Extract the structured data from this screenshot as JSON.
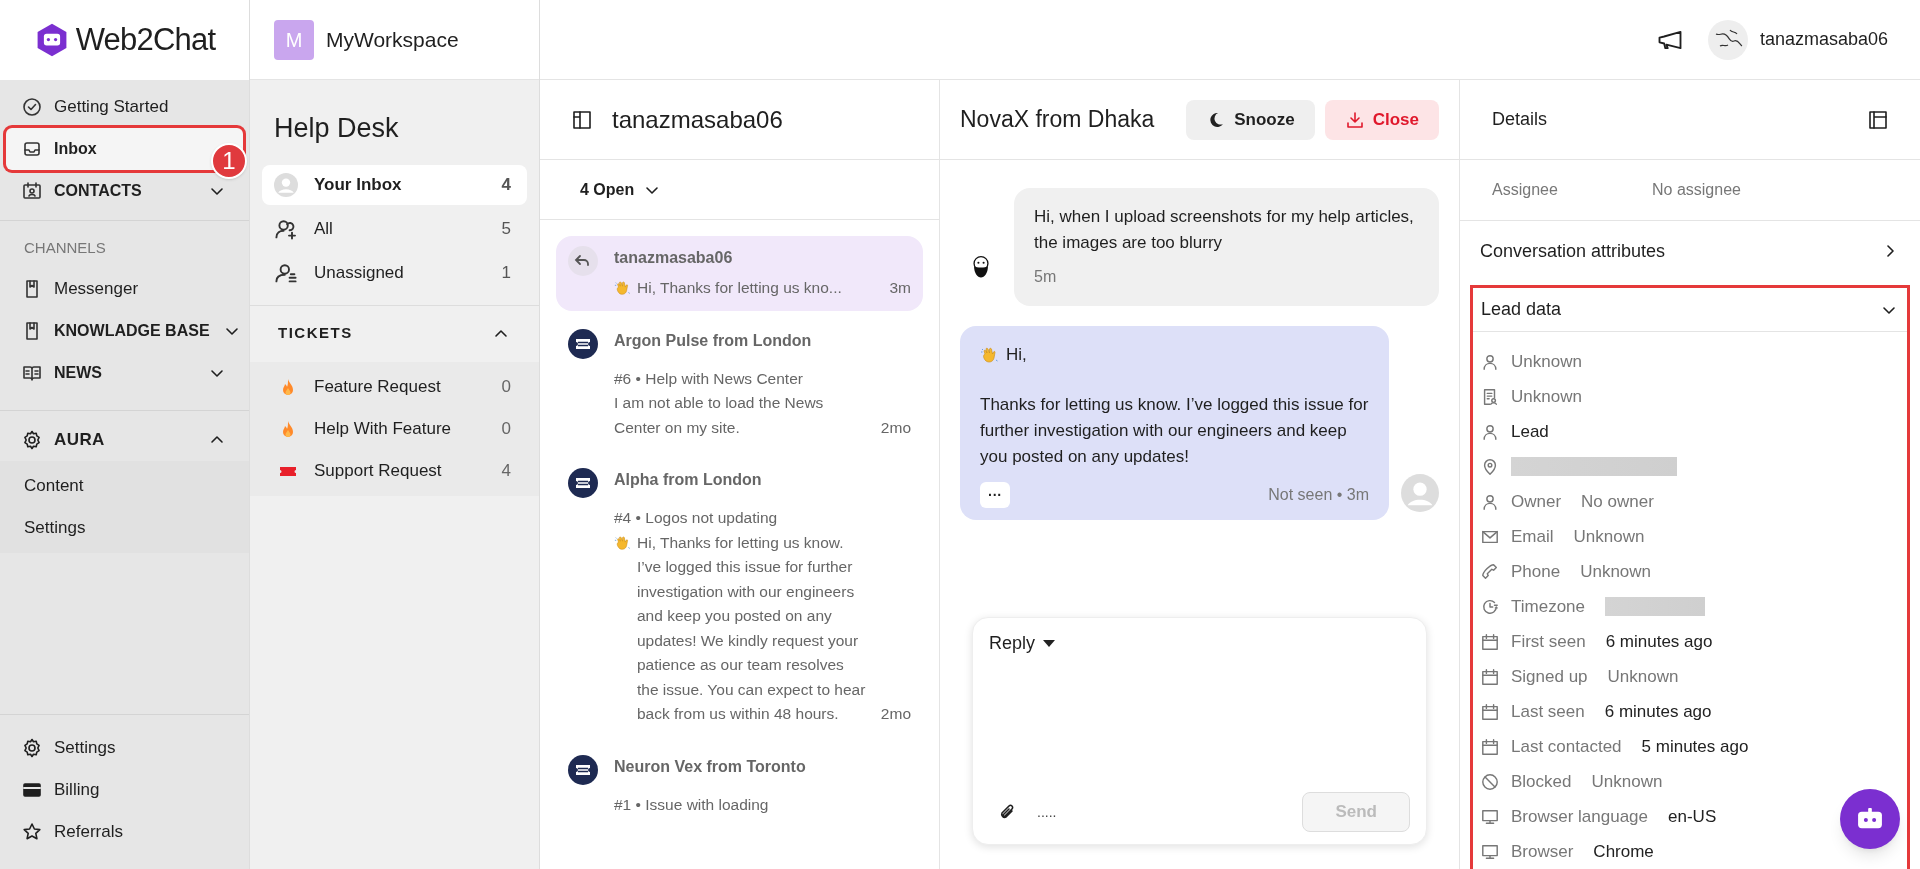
{
  "brand": {
    "name": "Web2Chat"
  },
  "workspace": {
    "initial": "M",
    "name": "MyWorkspace"
  },
  "topbar": {
    "user": "tanazmasaba06"
  },
  "nav": {
    "top": [
      {
        "kind": "check",
        "label": "Getting Started",
        "bold": false,
        "selected": false,
        "highlighted": false
      },
      {
        "kind": "inbox",
        "label": "Inbox",
        "bold": true,
        "selected": true,
        "highlighted": true,
        "callout": "1"
      },
      {
        "kind": "contacts",
        "label": "CONTACTS",
        "bold": true,
        "selected": false,
        "highlighted": false,
        "expanded": false
      }
    ],
    "channels_heading": "CHANNELS",
    "channels": [
      {
        "kind": "book",
        "label": "Messenger",
        "bold": false,
        "selected": false,
        "highlighted": false
      },
      {
        "kind": "book",
        "label": "KNOWLADGE BASE",
        "bold": true,
        "selected": false,
        "highlighted": false,
        "expanded": false
      },
      {
        "kind": "news",
        "label": "NEWS",
        "bold": true,
        "selected": false,
        "highlighted": false,
        "expanded": false
      }
    ],
    "aura": {
      "label": "AURA",
      "expanded": true,
      "children": [
        {
          "label": "Content"
        },
        {
          "label": "Settings"
        }
      ]
    },
    "bottom": [
      {
        "kind": "gear",
        "label": "Settings"
      },
      {
        "kind": "card",
        "label": "Billing"
      },
      {
        "kind": "star",
        "label": "Referrals"
      }
    ]
  },
  "helpdesk": {
    "title": "Help Desk",
    "views": [
      {
        "kind": "avatar",
        "label": "Your Inbox",
        "count": "4",
        "selected": true
      },
      {
        "kind": "people",
        "label": "All",
        "count": "5",
        "selected": false
      },
      {
        "kind": "unassigned",
        "label": "Unassigned",
        "count": "1",
        "selected": false
      }
    ],
    "tickets": {
      "label": "TICKETS",
      "expanded": true,
      "items": [
        {
          "kind": "flame",
          "label": "Feature Request",
          "count": "0"
        },
        {
          "kind": "flame",
          "label": "Help With Feature",
          "count": "0"
        },
        {
          "kind": "ticket",
          "label": "Support Request",
          "count": "4"
        }
      ]
    }
  },
  "conversations": {
    "title": "tanazmasaba06",
    "filter": "4 Open",
    "items": [
      {
        "kind": "reply",
        "name": "tanazmasaba06",
        "preview": "Hi, Thanks for letting us kno...",
        "wave": true,
        "time": "3m",
        "selected": true
      },
      {
        "kind": "ticket",
        "name": "Argon Pulse from London",
        "subject": "#6 • Help with News Center",
        "preview": "I am not able to load the News Center on my site.",
        "wave": false,
        "time": "2mo",
        "selected": false
      },
      {
        "kind": "ticket",
        "name": "Alpha from London",
        "subject": "#4 • Logos not updating",
        "preview": "Hi, Thanks for letting us know. I’ve logged this issue for further investigation with our engineers and keep you posted on any updates! We kindly request your patience as our team resolves the issue. You can expect to hear back from us within 48 hours.",
        "wave": true,
        "time": "2mo",
        "selected": false
      },
      {
        "kind": "ticket",
        "name": "Neuron Vex from Toronto",
        "subject": "#1 • Issue with loading",
        "selected": false
      }
    ]
  },
  "chat": {
    "title": "NovaX from Dhaka",
    "snooze": "Snooze",
    "close": "Close",
    "messages": [
      {
        "kind": "incoming",
        "paragraphs": [
          "Hi, when I upload screenshots for my help articles, the images are too blurry"
        ],
        "time": "5m"
      },
      {
        "kind": "outgoing",
        "greeting": "Hi,",
        "paragraphs": [
          "Thanks for letting us know. I’ve logged this issue for further investigation with our engineers and keep you posted on any updates!"
        ],
        "more": "···",
        "status": "Not seen • 3m"
      }
    ],
    "composer": {
      "mode": "Reply",
      "hint": ".....",
      "send": "Send",
      "send_disabled": true
    }
  },
  "details": {
    "title": "Details",
    "assignee": {
      "label": "Assignee",
      "value": "No assignee"
    },
    "attributes": {
      "label": "Conversation attributes",
      "expanded": false
    },
    "lead_data": {
      "label": "Lead data",
      "expanded": true,
      "highlighted": true,
      "rows": [
        {
          "kind": "person",
          "value": "Unknown",
          "muted": true
        },
        {
          "kind": "contact-card",
          "value": "Unknown",
          "muted": true
        },
        {
          "kind": "person",
          "value": "Lead",
          "muted": false
        },
        {
          "kind": "location",
          "redacted": true
        },
        {
          "kind": "person",
          "label": "Owner",
          "value": "No owner",
          "muted": true
        },
        {
          "kind": "email",
          "label": "Email",
          "value": "Unknown",
          "muted": true
        },
        {
          "kind": "phone",
          "label": "Phone",
          "value": "Unknown",
          "muted": true
        },
        {
          "kind": "timezone",
          "label": "Timezone",
          "redacted": true
        },
        {
          "kind": "date",
          "label": "First seen",
          "value": "6 minutes ago",
          "muted": false
        },
        {
          "kind": "date",
          "label": "Signed up",
          "value": "Unknown",
          "muted": true
        },
        {
          "kind": "date",
          "label": "Last seen",
          "value": "6 minutes ago",
          "muted": false
        },
        {
          "kind": "date",
          "label": "Last contacted",
          "value": "5 minutes ago",
          "muted": false
        },
        {
          "kind": "blocked",
          "label": "Blocked",
          "value": "Unknown",
          "muted": true
        },
        {
          "kind": "browser",
          "label": "Browser language",
          "value": "en-US",
          "muted": false
        },
        {
          "kind": "browser",
          "label": "Browser",
          "value": "Chrome",
          "muted": false
        }
      ]
    }
  }
}
